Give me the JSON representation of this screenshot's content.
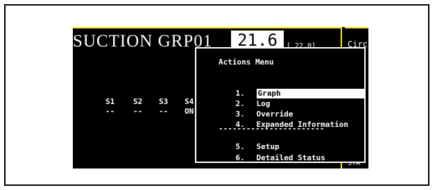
{
  "screen": {
    "group_title": "SUCTION GRP01",
    "value": "21.6",
    "setpoint": "[ 22.0]",
    "stages": [
      {
        "label": "S1",
        "status": "--"
      },
      {
        "label": "S2",
        "status": "--"
      },
      {
        "label": "S3",
        "status": "--"
      },
      {
        "label": "S4",
        "status": "ON"
      }
    ],
    "right_panel_title": "Circ",
    "right_panel_footer": "STA"
  },
  "actions_menu": {
    "title": "Actions Menu",
    "items": [
      {
        "number": "1.",
        "label": "Graph",
        "selected": true
      },
      {
        "number": "2.",
        "label": "Log"
      },
      {
        "number": "3.",
        "label": "Override"
      },
      {
        "number": "4.",
        "label": "Expanded Information"
      },
      {
        "number": "5.",
        "label": "Setup"
      },
      {
        "number": "6.",
        "label": "Detailed Status"
      }
    ],
    "separator": "-----------------------"
  },
  "colors": {
    "screen_bg": "#000000",
    "text": "#ffffff",
    "accent_border": "#ffee00",
    "selection_bg": "#ffffff"
  }
}
